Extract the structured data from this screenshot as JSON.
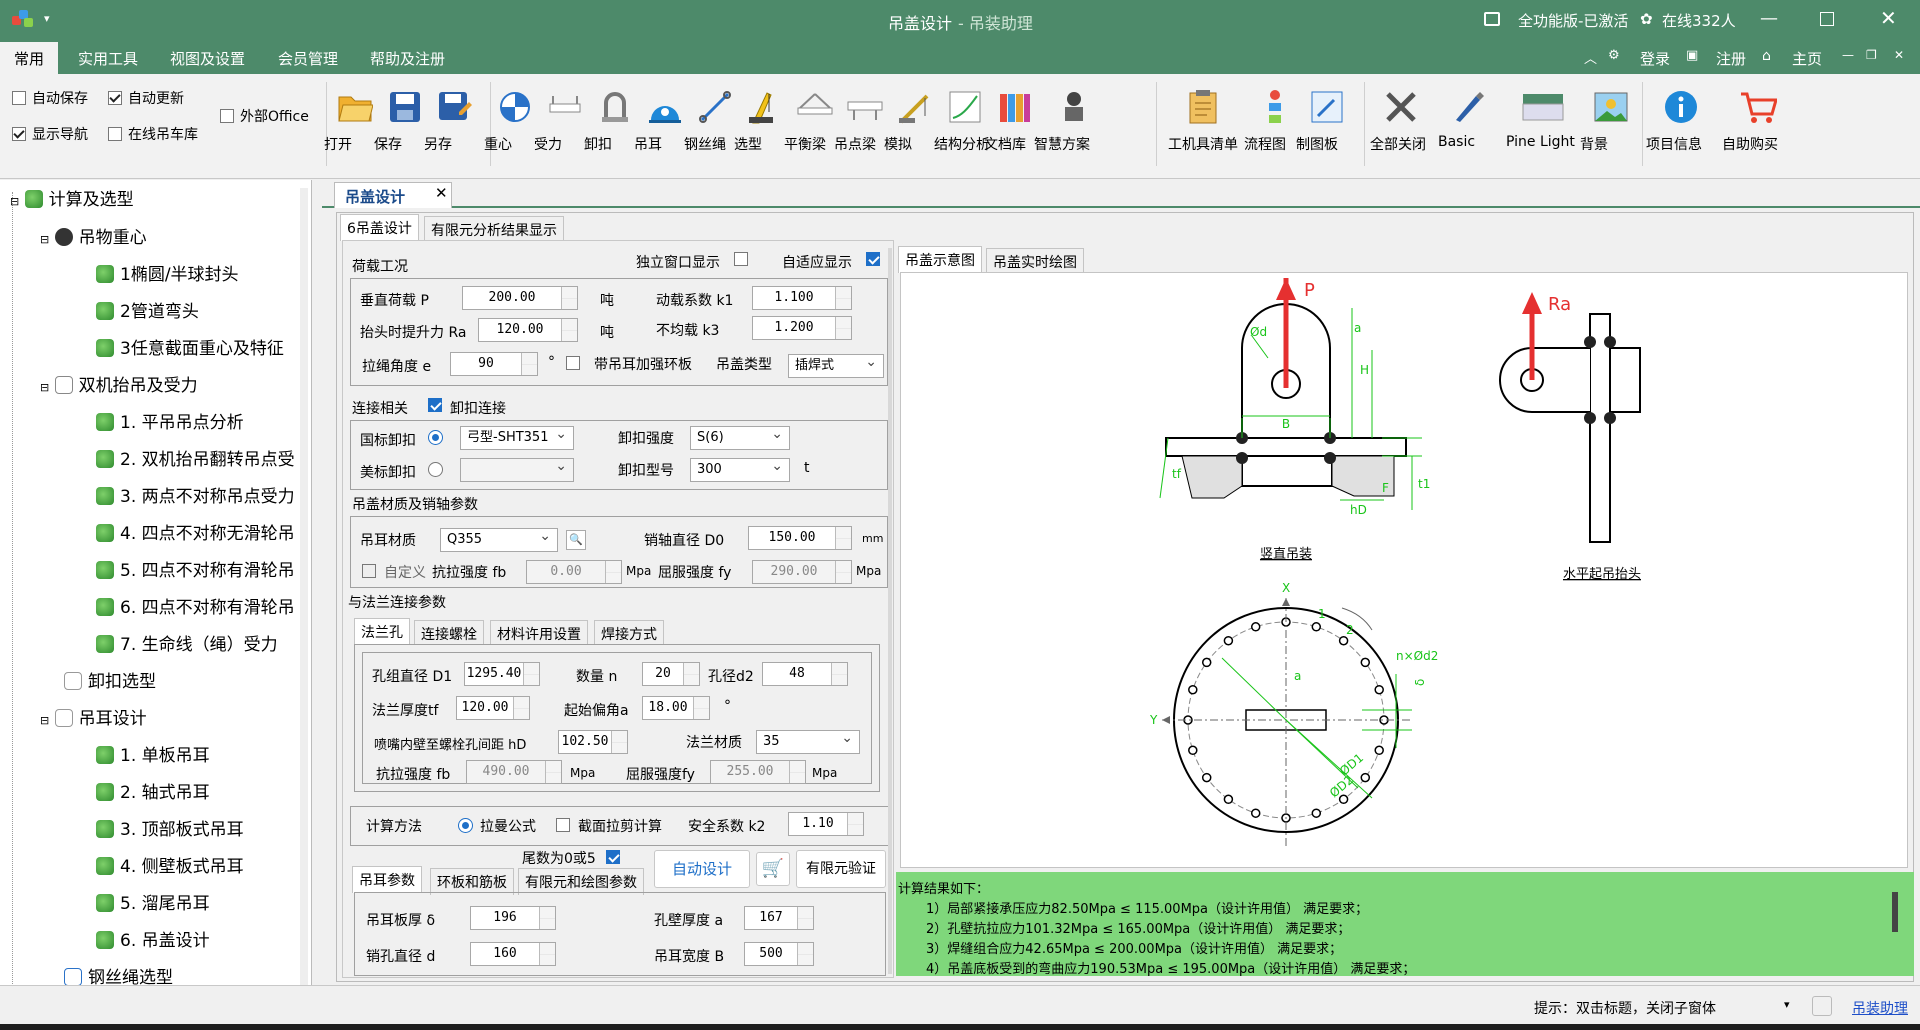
{
  "window": {
    "title": "吊盖设计",
    "subtitle": "- 吊装助理",
    "license": "全功能版-已激活",
    "online": "在线332人"
  },
  "menu": {
    "items": [
      "常用",
      "实用工具",
      "视图及设置",
      "会员管理",
      "帮助及注册"
    ],
    "right": [
      "登录",
      "注册",
      "主页"
    ]
  },
  "options": {
    "autosave": "自动保存",
    "autoupdate": "自动更新",
    "office": "外部Office",
    "shownav": "显示导航",
    "online_lib": "在线吊车库"
  },
  "ribbon": {
    "buttons": [
      "打开",
      "保存",
      "另存",
      "重心",
      "受力",
      "卸扣",
      "吊耳",
      "钢丝绳",
      "选型",
      "平衡梁",
      "吊点梁",
      "模拟",
      "结构分析",
      "文档库",
      "智慧方案",
      "工机具清单",
      "流程图",
      "制图板",
      "全部关闭",
      "Basic",
      "Pine Light",
      "背景",
      "项目信息",
      "自助购买"
    ]
  },
  "tree": {
    "root": "计算及选型",
    "g1": "吊物重心",
    "g1_items": [
      "1椭圆/半球封头",
      "2管道弯头",
      "3任意截面重心及特征"
    ],
    "g2": "双机抬吊及受力",
    "g2_items": [
      "1. 平吊吊点分析",
      "2. 双机抬吊翻转吊点受",
      "3. 两点不对称吊点受力",
      "4. 四点不对称无滑轮吊",
      "5. 四点不对称有滑轮吊",
      "6. 四点不对称有滑轮吊",
      "7. 生命线（绳）受力"
    ],
    "g3": "卸扣选型",
    "g4": "吊耳设计",
    "g4_items": [
      "1. 单板吊耳",
      "2. 轴式吊耳",
      "3. 顶部板式吊耳",
      "4. 侧壁板式吊耳",
      "5. 溜尾吊耳",
      "6. 吊盖设计"
    ],
    "g5": "钢丝绳选型"
  },
  "doc_tab": "吊盖设计",
  "subtabs": [
    "6吊盖设计",
    "有限元分析结果显示"
  ],
  "load": {
    "title": "荷载工况",
    "independent": "独立窗口显示",
    "adaptive": "自适应显示",
    "p_label": "垂直荷载 P",
    "p_val": "200.00",
    "p_unit": "吨",
    "k1_label": "动载系数 k1",
    "k1_val": "1.100",
    "ra_label": "抬头时提升力 Ra",
    "ra_val": "120.00",
    "ra_unit": "吨",
    "k3_label": "不均载 k3",
    "k3_val": "1.200",
    "angle_label": "拉绳角度 e",
    "angle_val": "90",
    "angle_unit": "°",
    "ring_label": "带吊耳加强环板",
    "type_label": "吊盖类型",
    "type_val": "插焊式"
  },
  "connect": {
    "title": "连接相关",
    "shackle": "卸扣连接",
    "gb": "国标卸扣",
    "gb_val": "弓型-SHT351",
    "strength": "卸扣强度",
    "strength_val": "S(6)",
    "us": "美标卸扣",
    "model": "卸扣型号",
    "model_val": "300",
    "model_unit": "t"
  },
  "material": {
    "title": "吊盖材质及销轴参数",
    "mat_label": "吊耳材质",
    "mat_val": "Q355",
    "d0_label": "销轴直径 D0",
    "d0_val": "150.00",
    "mm": "mm",
    "custom": "自定义",
    "fb_label": "抗拉强度 fb",
    "fb_val": "0.00",
    "mpa": "Mpa",
    "fy_label": "屈服强度 fy",
    "fy_val": "290.00"
  },
  "flange": {
    "title": "与法兰连接参数",
    "tabs": [
      "法兰孔",
      "连接螺栓",
      "材料许用设置",
      "焊接方式"
    ],
    "d1_label": "孔组直径 D1",
    "d1_val": "1295.40",
    "n_label": "数量 n",
    "n_val": "20",
    "d2_label": "孔径d2",
    "d2_val": "48",
    "tf_label": "法兰厚度tf",
    "tf_val": "120.00",
    "a_label": "起始偏角a",
    "a_val": "18.00",
    "deg": "°",
    "hd_label": "喷嘴内壁至螺栓孔间距 hD",
    "hd_val": "102.50",
    "fmat_label": "法兰材质",
    "fmat_val": "35",
    "ffb_label": "抗拉强度 fb",
    "ffb_val": "490.00",
    "ffy_label": "屈服强度fy",
    "ffy_val": "255.00"
  },
  "calc": {
    "label": "计算方法",
    "m1": "拉曼公式",
    "m2": "截面拉剪计算",
    "k2_label": "安全系数 k2",
    "k2_val": "1.10",
    "tail": "尾数为0或5",
    "auto": "自动设计",
    "fem": "有限元验证"
  },
  "lug": {
    "tabs": [
      "吊耳参数",
      "环板和筋板",
      "有限元和绘图参数"
    ],
    "t_label": "吊耳板厚  δ",
    "t_val": "196",
    "a_label": "孔壁厚度 a",
    "a_val": "167",
    "d_label": "销孔直径  d",
    "d_val": "160",
    "b_label": "吊耳宽度 B",
    "b_val": "500"
  },
  "drawing": {
    "tabs": [
      "吊盖示意图",
      "吊盖实时绘图"
    ],
    "caption1": "竖直吊装",
    "caption2": "水平起吊抬头",
    "labels": {
      "P": "P",
      "Ra": "Ra",
      "d": "Ød",
      "a": "a",
      "B": "B",
      "H": "H",
      "tf": "tf",
      "F": "F",
      "hD": "hD",
      "t1": "t1",
      "X": "X",
      "Y": "Y",
      "n1": "1",
      "n2": "2",
      "nd2": "n×Ød2",
      "D1": "ØD1",
      "D2": "ØD2",
      "a2": "a",
      "delta": "δ"
    }
  },
  "results": {
    "title": "计算结果如下：",
    "lines": [
      "1）局部紧接承压应力82.50Mpa ≤ 115.00Mpa（设计许用值） 满足要求；",
      "2）孔壁抗拉应力101.32Mpa ≤ 165.00Mpa（设计许用值） 满足要求；",
      "3）焊缝组合应力42.65Mpa ≤ 200.00Mpa（设计许用值） 满足要求；",
      "4）吊盖底板受到的弯曲应力190.53Mpa ≤ 195.00Mpa（设计许用值） 满足要求；"
    ]
  },
  "status": {
    "hint": "提示：双击标题，关闭子窗体",
    "link": "吊装助理"
  }
}
